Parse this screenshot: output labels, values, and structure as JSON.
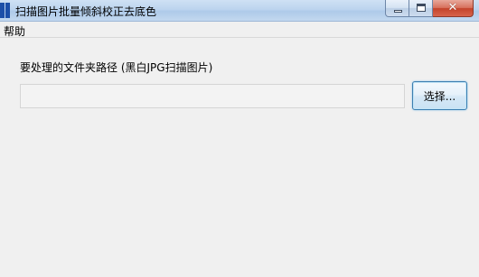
{
  "window": {
    "title": "扫描图片批量倾斜校正去底色",
    "icon": "app-logo-icon",
    "controls": {
      "minimize_icon": "minimize-icon",
      "maximize_icon": "maximize-icon",
      "close_icon": "close-icon",
      "close_glyph": "✕"
    }
  },
  "menu": {
    "items": [
      {
        "label": "帮助"
      }
    ]
  },
  "form": {
    "path_label": "要处理的文件夹路径 (黑白JPG扫描图片)",
    "path_value": "",
    "browse_label": "选择..."
  },
  "colors": {
    "accent": "#3c7fb1",
    "background": "#f0f0f0",
    "titlebar": "#bcd4ee"
  }
}
